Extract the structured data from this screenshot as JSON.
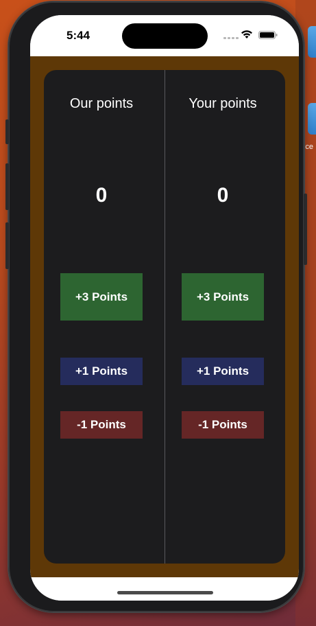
{
  "status_bar": {
    "time": "5:44"
  },
  "desktop": {
    "partial_label": "ce"
  },
  "scoreboard": {
    "columns": [
      {
        "title": "Our points",
        "score": "0",
        "buttons": {
          "plus3": "+3 Points",
          "plus1": "+1 Points",
          "minus1": "-1 Points"
        }
      },
      {
        "title": "Your points",
        "score": "0",
        "buttons": {
          "plus3": "+3 Points",
          "plus1": "+1 Points",
          "minus1": "-1 Points"
        }
      }
    ]
  },
  "colors": {
    "app_background": "#5e3807",
    "card_background": "#1c1c1e",
    "plus3_button": "#2d6531",
    "plus1_button": "#252c5c",
    "minus1_button": "#652626",
    "text": "#ffffff"
  },
  "icons": {
    "signal": "cellular-signal-icon",
    "wifi": "wifi-icon",
    "battery": "battery-icon"
  }
}
